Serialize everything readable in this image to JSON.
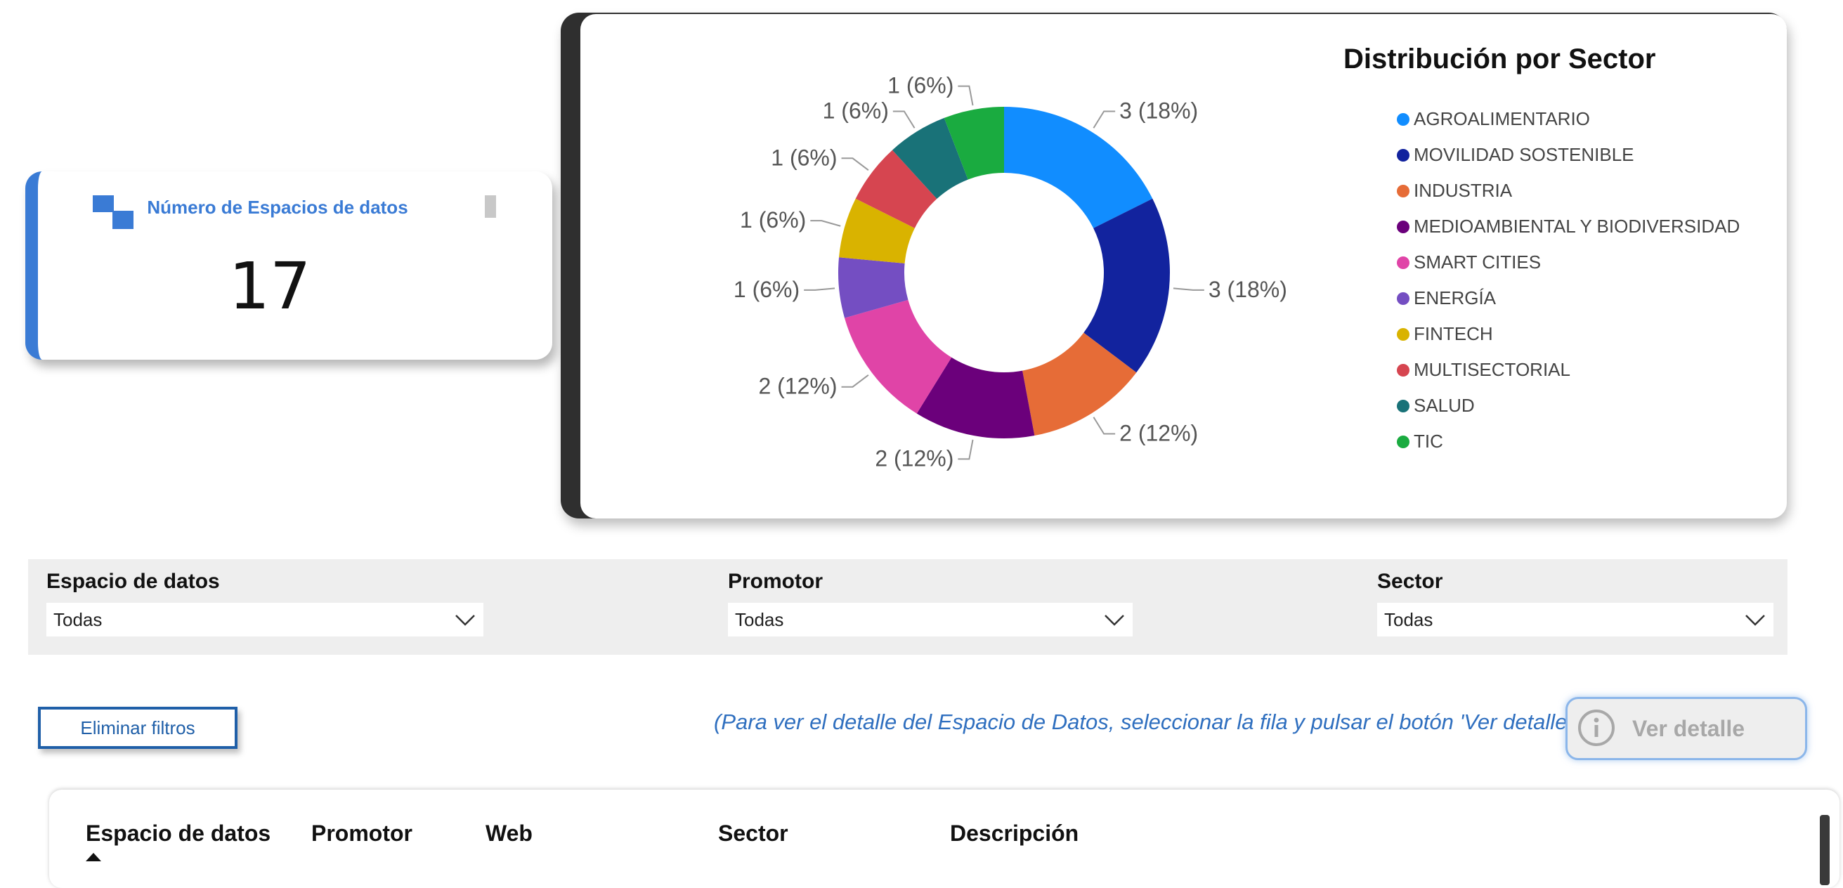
{
  "kpi": {
    "title": "Número de Espacios de datos",
    "value": "17"
  },
  "chart_data": {
    "type": "pie",
    "title": "Distribución por Sector",
    "categories": [
      "AGROALIMENTARIO",
      "MOVILIDAD SOSTENIBLE",
      "INDUSTRIA",
      "MEDIOAMBIENTAL Y BIODIVERSIDAD",
      "SMART CITIES",
      "ENERGÍA",
      "FINTECH",
      "MULTISECTORIAL",
      "SALUD",
      "TIC"
    ],
    "values": [
      3,
      3,
      2,
      2,
      2,
      1,
      1,
      1,
      1,
      1
    ],
    "data_labels": [
      "3 (18%)",
      "3 (18%)",
      "2 (12%)",
      "2 (12%)",
      "2 (12%)",
      "1 (6%)",
      "1 (6%)",
      "1 (6%)",
      "1 (6%)",
      "1 (6%)"
    ],
    "colors": [
      "#118dff",
      "#12239e",
      "#e66c37",
      "#6b007b",
      "#e044a7",
      "#744ec2",
      "#d9b300",
      "#d64550",
      "#197278",
      "#1aab40"
    ],
    "legend_position": "right"
  },
  "filters": [
    {
      "label": "Espacio de datos",
      "value": "Todas"
    },
    {
      "label": "Promotor",
      "value": "Todas"
    },
    {
      "label": "Sector",
      "value": "Todas"
    }
  ],
  "actions": {
    "clear_filters": "Eliminar filtros",
    "hint": "(Para ver el detalle del Espacio de Datos, seleccionar la fila y pulsar el botón 'Ver detalle')'",
    "detail_button": "Ver detalle",
    "detail_icon": "info-icon"
  },
  "table": {
    "columns": [
      "Espacio de datos",
      "Promotor",
      "Web",
      "Sector",
      "Descripción"
    ],
    "sorted_column": "Espacio de datos"
  }
}
